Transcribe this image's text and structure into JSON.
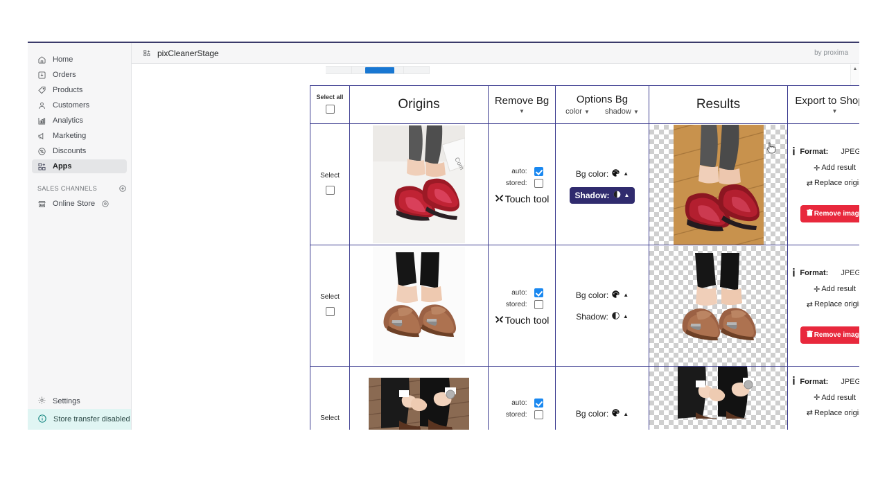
{
  "sidebar": {
    "items": [
      {
        "label": "Home",
        "icon": "home-icon"
      },
      {
        "label": "Orders",
        "icon": "orders-icon"
      },
      {
        "label": "Products",
        "icon": "products-tag-icon"
      },
      {
        "label": "Customers",
        "icon": "customers-person-icon"
      },
      {
        "label": "Analytics",
        "icon": "analytics-bars-icon"
      },
      {
        "label": "Marketing",
        "icon": "marketing-megaphone-icon"
      },
      {
        "label": "Discounts",
        "icon": "discounts-percent-icon"
      },
      {
        "label": "Apps",
        "icon": "apps-grid-icon"
      }
    ],
    "section_title": "SALES CHANNELS",
    "channels": [
      {
        "label": "Online Store",
        "icon": "online-store-icon"
      }
    ],
    "settings_label": "Settings",
    "transfer_label": "Store transfer disabled"
  },
  "topbar": {
    "app_title": "pixCleanerStage",
    "byline": "by proxima"
  },
  "table": {
    "headers": {
      "select_all": "Select all",
      "origins": "Origins",
      "remove_bg": "Remove Bg",
      "options_bg": "Options Bg",
      "options_color": "color",
      "options_shadow": "shadow",
      "results": "Results",
      "export": "Export to Shopify"
    },
    "rows": [
      {
        "select_label": "Select",
        "select_checked": false,
        "auto_label": "auto:",
        "auto_checked": true,
        "stored_label": "stored:",
        "stored_checked": false,
        "touch_tool_label": "Touch tool",
        "bg_color_label": "Bg color:",
        "bg_color_active": false,
        "shadow_label": "Shadow:",
        "shadow_active": true,
        "format_label": "Format:",
        "format_value": "JPEG",
        "add_result_label": "Add result",
        "replace_origin_label": "Replace origin",
        "remove_image_label": "Remove image"
      },
      {
        "select_label": "Select",
        "select_checked": false,
        "auto_label": "auto:",
        "auto_checked": true,
        "stored_label": "stored:",
        "stored_checked": false,
        "touch_tool_label": "Touch tool",
        "bg_color_label": "Bg color:",
        "bg_color_active": false,
        "shadow_label": "Shadow:",
        "shadow_active": false,
        "format_label": "Format:",
        "format_value": "JPEG",
        "add_result_label": "Add result",
        "replace_origin_label": "Replace origin",
        "remove_image_label": "Remove image"
      },
      {
        "select_label": "Select",
        "select_checked": false,
        "auto_label": "auto:",
        "auto_checked": true,
        "stored_label": "stored:",
        "stored_checked": false,
        "bg_color_label": "Bg color:",
        "bg_color_active": false,
        "format_label": "Format:",
        "format_value": "JPEG",
        "add_result_label": "Add result",
        "replace_origin_label": "Replace origin"
      }
    ]
  },
  "colors": {
    "grid_border": "#3b3b8f",
    "active_button": "#302b6e",
    "remove_button": "#e8283c",
    "checkbox_checked": "#1a88f0",
    "scroll_thumb": "#1877d2",
    "banner_bg": "#e0f5f3"
  }
}
